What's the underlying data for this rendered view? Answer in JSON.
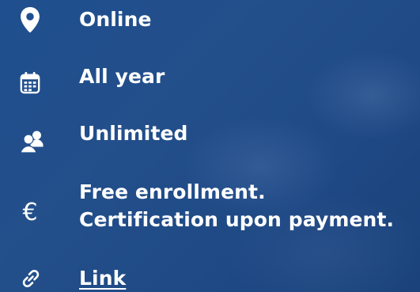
{
  "colors": {
    "background": "#1f4f8f",
    "text": "#ffffff"
  },
  "info_list": {
    "items": [
      {
        "icon": "location-pin-icon",
        "label": "Online"
      },
      {
        "icon": "calendar-icon",
        "label": "All year"
      },
      {
        "icon": "users-icon",
        "label": "Unlimited"
      },
      {
        "icon": "euro-icon",
        "label_line1": "Free enrollment.",
        "label_line2": "Certification upon payment."
      },
      {
        "icon": "link-icon",
        "label": "Link"
      }
    ]
  }
}
